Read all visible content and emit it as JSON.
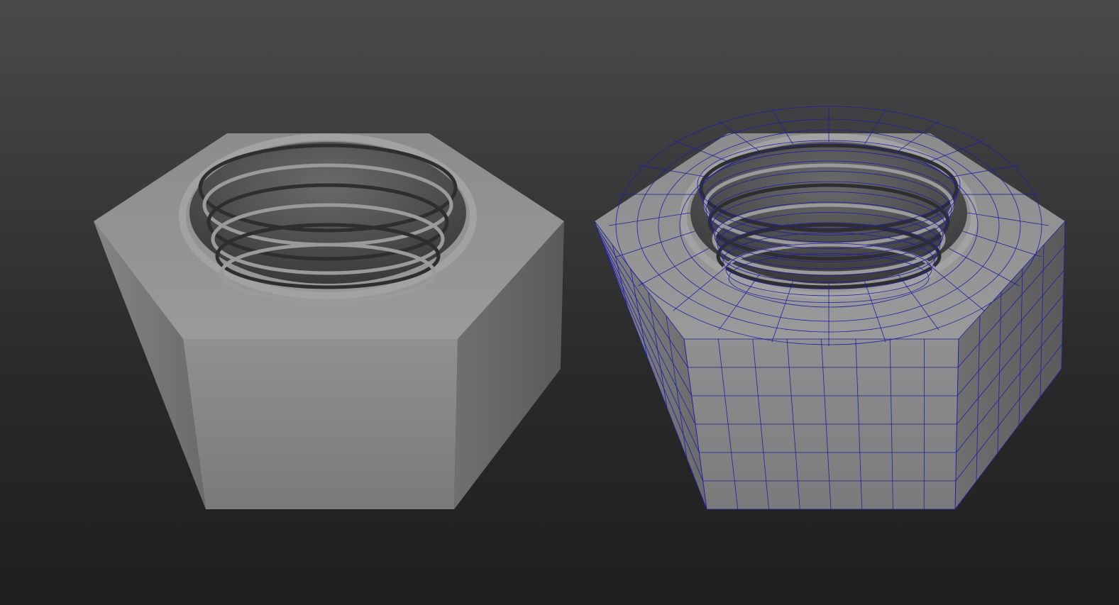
{
  "scene": {
    "models": [
      {
        "name": "hex-nut-shaded",
        "wireframe": false
      },
      {
        "name": "hex-nut-wireframe",
        "wireframe": true
      }
    ],
    "colors": {
      "surface": "#8a8a8a",
      "wire": "#1e1ea8",
      "background_top": "#4a4a4a",
      "background_bottom": "#1f1f1f"
    }
  }
}
